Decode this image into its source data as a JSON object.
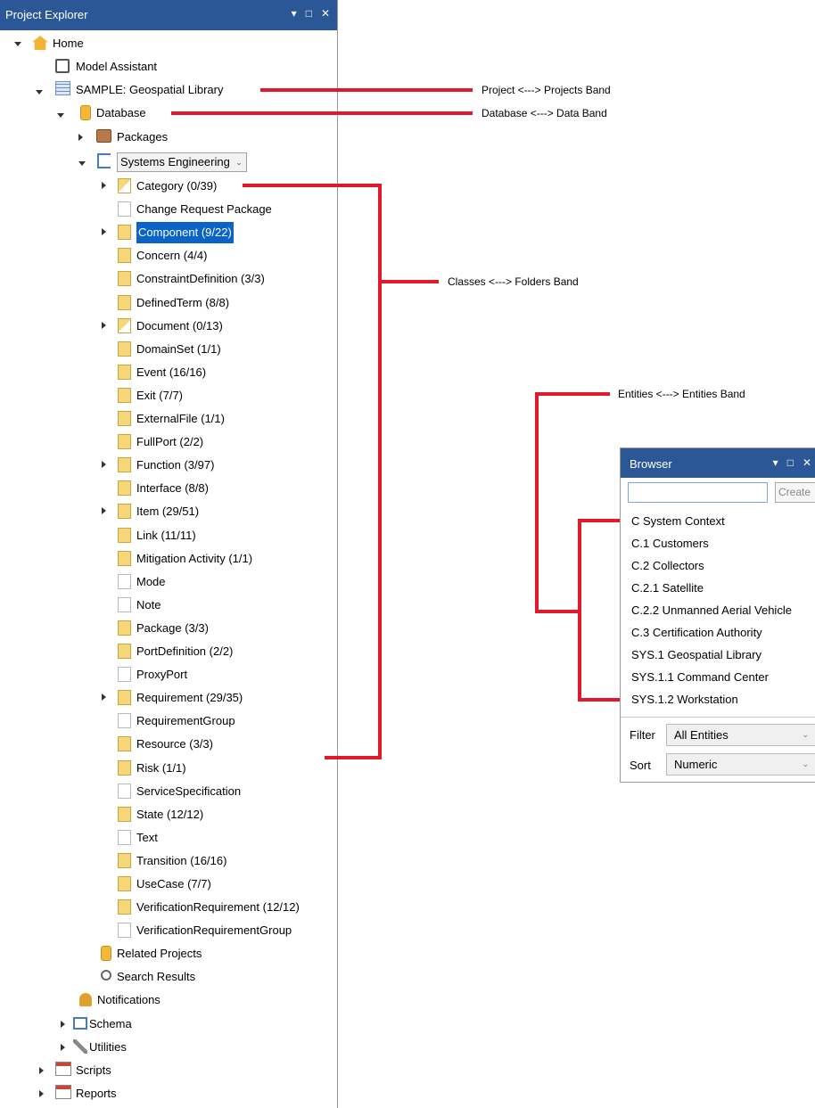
{
  "project_explorer": {
    "title": "Project Explorer",
    "window_buttons": {
      "pin": "▾",
      "maximize": "□",
      "close": "✕"
    },
    "tree": {
      "home": "Home",
      "model_assistant": "Model Assistant",
      "project": "SAMPLE: Geospatial Library",
      "database": "Database",
      "packages": "Packages",
      "facility": "Systems Engineering",
      "classes": [
        {
          "label": "Category  (0/39)"
        },
        {
          "label": "Change Request Package"
        },
        {
          "label": "Component  (9/22)"
        },
        {
          "label": "Concern  (4/4)"
        },
        {
          "label": "ConstraintDefinition  (3/3)"
        },
        {
          "label": "DefinedTerm  (8/8)"
        },
        {
          "label": "Document  (0/13)"
        },
        {
          "label": "DomainSet  (1/1)"
        },
        {
          "label": "Event  (16/16)"
        },
        {
          "label": "Exit  (7/7)"
        },
        {
          "label": "ExternalFile  (1/1)"
        },
        {
          "label": "FullPort  (2/2)"
        },
        {
          "label": "Function  (3/97)"
        },
        {
          "label": "Interface  (8/8)"
        },
        {
          "label": "Item  (29/51)"
        },
        {
          "label": "Link  (11/11)"
        },
        {
          "label": "Mitigation Activity  (1/1)"
        },
        {
          "label": "Mode"
        },
        {
          "label": "Note"
        },
        {
          "label": "Package  (3/3)"
        },
        {
          "label": "PortDefinition  (2/2)"
        },
        {
          "label": "ProxyPort"
        },
        {
          "label": "Requirement  (29/35)"
        },
        {
          "label": "RequirementGroup"
        },
        {
          "label": "Resource  (3/3)"
        },
        {
          "label": "Risk  (1/1)"
        },
        {
          "label": "ServiceSpecification"
        },
        {
          "label": "State  (12/12)"
        },
        {
          "label": "Text"
        },
        {
          "label": "Transition  (16/16)"
        },
        {
          "label": "UseCase  (7/7)"
        },
        {
          "label": "VerificationRequirement  (12/12)"
        },
        {
          "label": "VerificationRequirementGroup"
        }
      ],
      "related_projects": "Related Projects",
      "search_results": "Search Results",
      "notifications": "Notifications",
      "schema": "Schema",
      "utilities": "Utilities",
      "scripts": "Scripts",
      "reports": "Reports"
    }
  },
  "annotations": {
    "project_band": "Project <---> Projects Band",
    "database_band": "Database <---> Data Band",
    "classes_band": "Classes <---> Folders Band",
    "entities_band": "Entities <---> Entities Band"
  },
  "browser": {
    "title": "Browser",
    "window_buttons": {
      "pin": "▾",
      "maximize": "□",
      "close": "✕"
    },
    "search_value": "",
    "create_label": "Create",
    "entities": [
      "C System Context",
      "C.1 Customers",
      "C.2 Collectors",
      "C.2.1 Satellite",
      "C.2.2 Unmanned Aerial Vehicle",
      "C.3 Certification Authority",
      "SYS.1 Geospatial Library",
      "SYS.1.1 Command Center",
      "SYS.1.2 Workstation"
    ],
    "filter_label": "Filter",
    "filter_value": "All Entities",
    "sort_label": "Sort",
    "sort_value": "Numeric"
  },
  "colors": {
    "titlebar": "#2b5797",
    "selection": "#0a64c8",
    "annotation_line": "#e0192c"
  },
  "selected_class_index": 2
}
